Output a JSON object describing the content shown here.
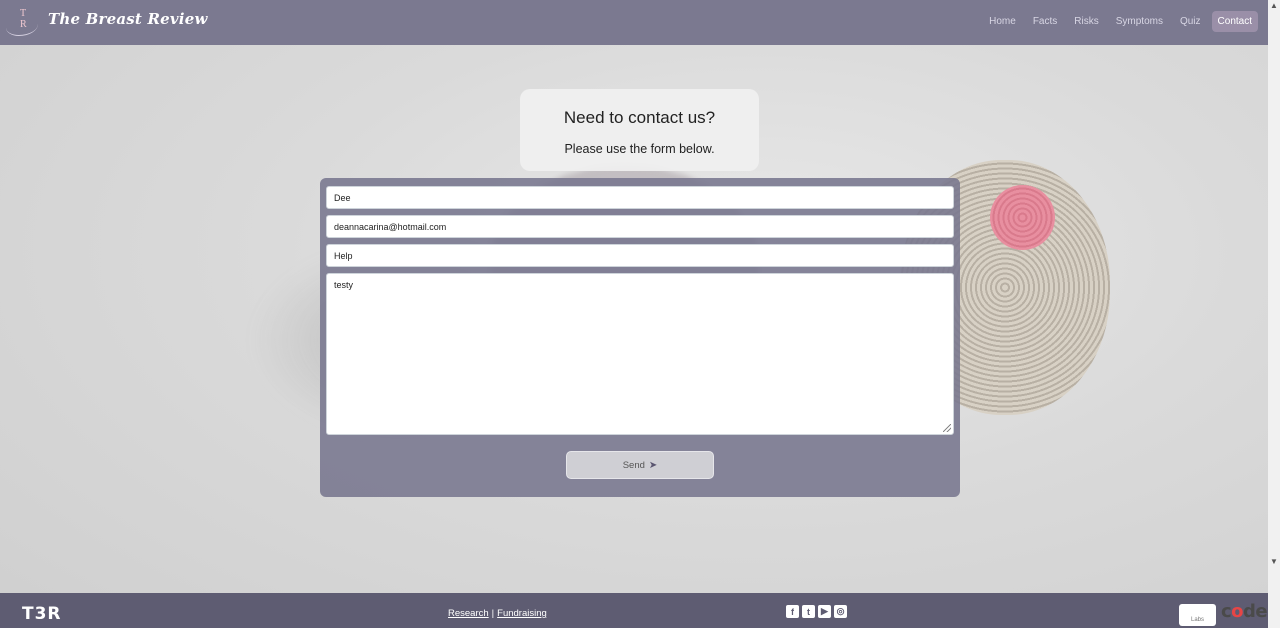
{
  "header": {
    "brand": "The Breast Review",
    "logo_text": "T R",
    "nav": [
      {
        "label": "Home",
        "active": false
      },
      {
        "label": "Facts",
        "active": false
      },
      {
        "label": "Risks",
        "active": false
      },
      {
        "label": "Symptoms",
        "active": false
      },
      {
        "label": "Quiz",
        "active": false
      },
      {
        "label": "Contact",
        "active": true
      }
    ]
  },
  "intro": {
    "title": "Need to contact us?",
    "subtitle": "Please use the form below."
  },
  "form": {
    "name_value": "Dee",
    "email_value": "deannacarina@hotmail.com",
    "subject_value": "Help",
    "message_value": "testy",
    "send_label": "Send"
  },
  "footer": {
    "logo": "T3R",
    "links": [
      {
        "label": "Research"
      },
      {
        "label": "Fundraising"
      }
    ],
    "separator": "|",
    "social_icons": [
      "facebook-icon",
      "twitter-icon",
      "youtube-icon",
      "instagram-icon"
    ],
    "sponsor_label": "Labs",
    "code_logo": {
      "prefix": "c",
      "o": "o",
      "suffix": "de"
    }
  },
  "colors": {
    "header_bg": "#7b7990",
    "footer_bg": "#5e5c72",
    "panel_bg": "#78768e",
    "active_nav_bg": "#9a8fa8"
  }
}
